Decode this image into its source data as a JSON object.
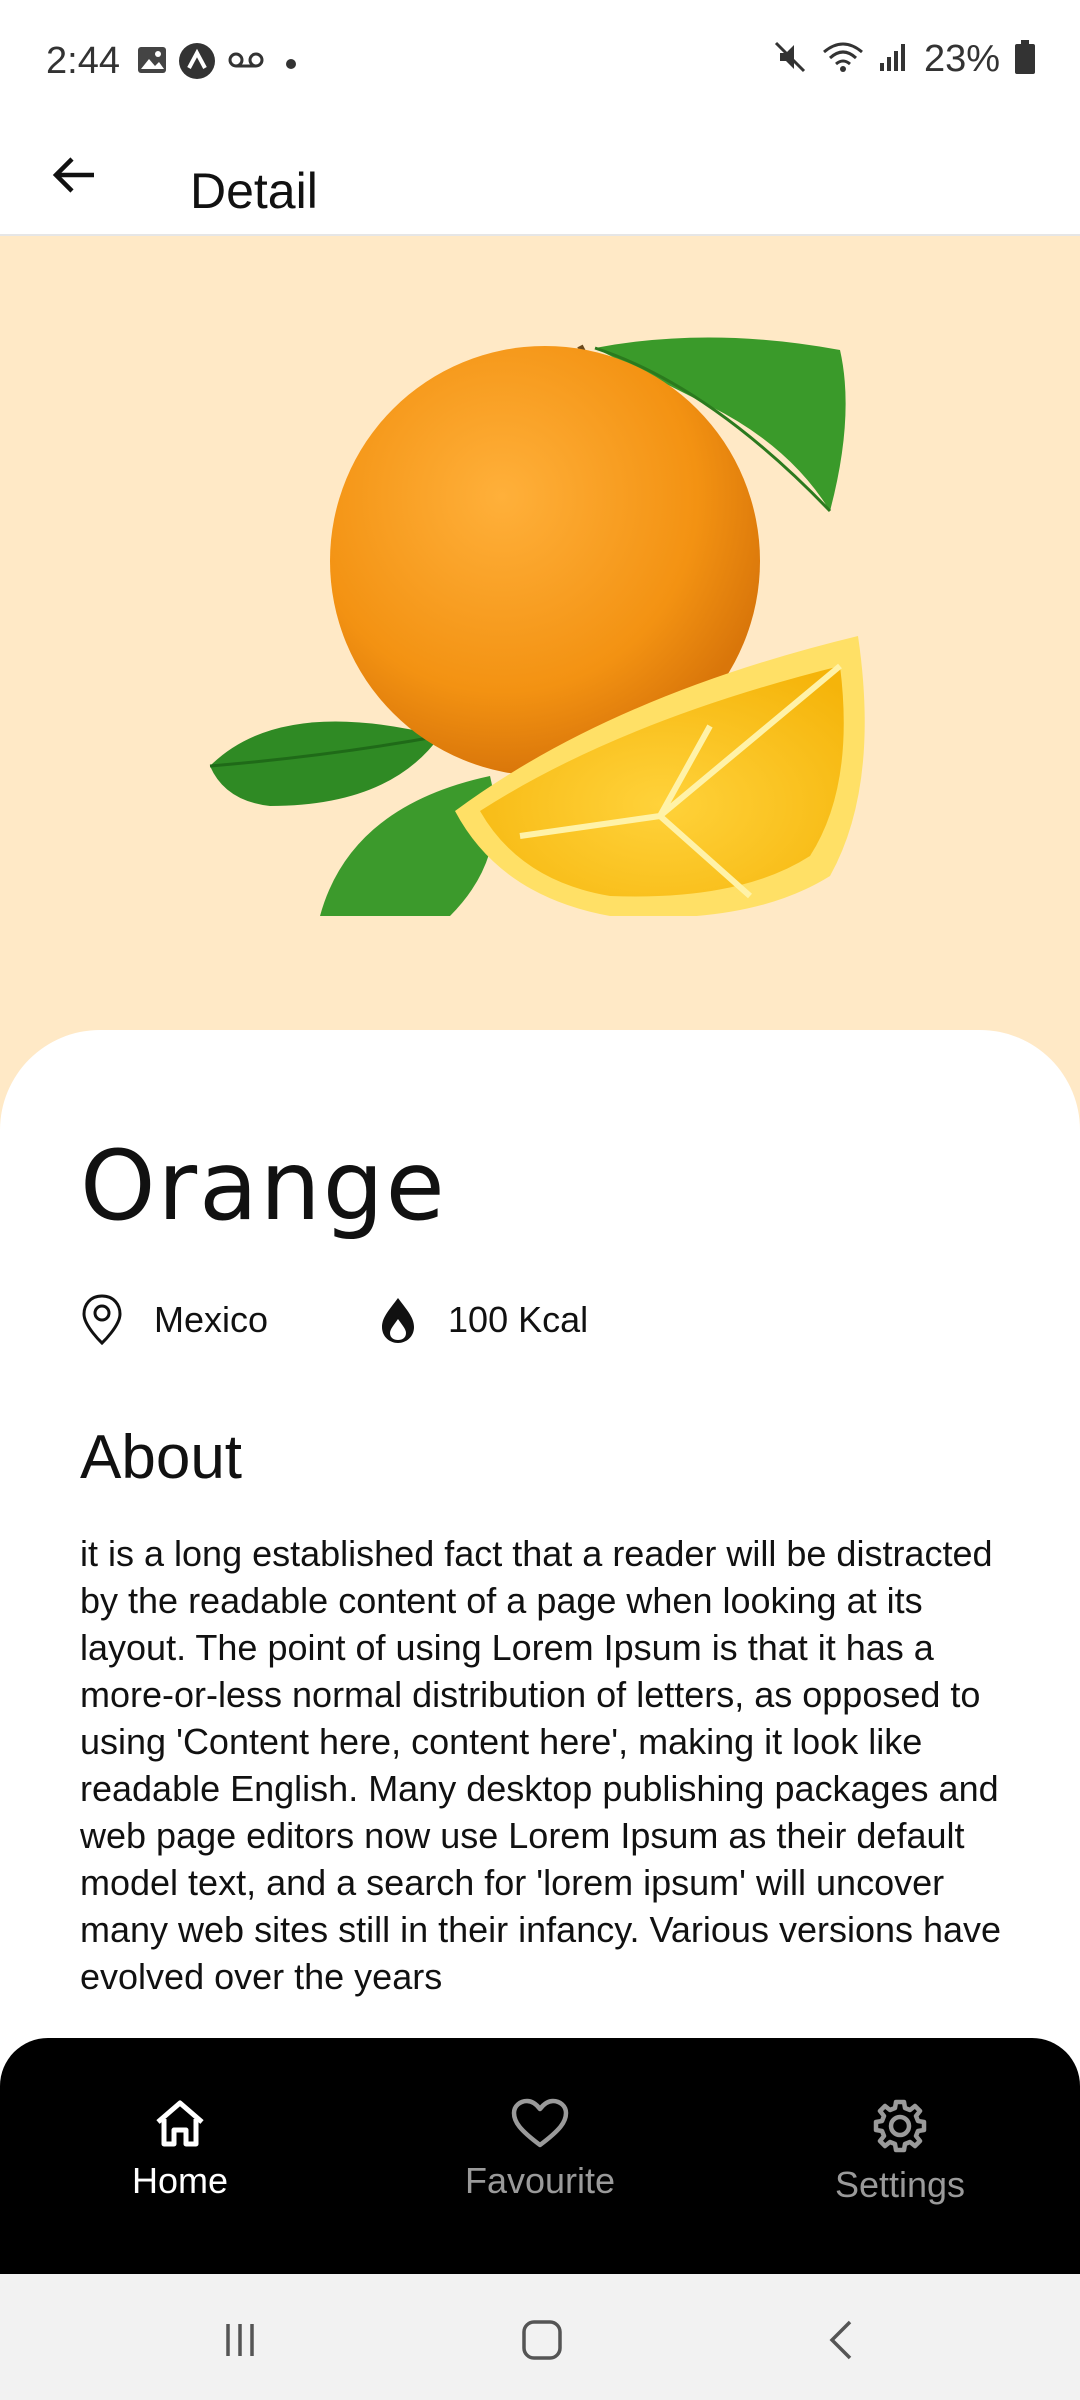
{
  "status_bar": {
    "time": "2:44",
    "battery_percent": "23%",
    "left_icons": [
      "gallery-icon",
      "app-notification-icon",
      "voicemail-icon",
      "dot-icon"
    ],
    "right_icons": [
      "mute-icon",
      "wifi-icon",
      "signal-icon",
      "battery-icon"
    ]
  },
  "app_bar": {
    "title": "Detail"
  },
  "hero": {
    "background_color": "#FFE9C6",
    "image": "orange-fruit-image"
  },
  "product": {
    "name": "Orange",
    "origin": "Mexico",
    "calories": "100 Kcal",
    "about_title": "About",
    "about_text": "it is a long established fact that a reader will be distracted by the readable content of a page when looking at its layout. The point of using Lorem Ipsum is that it has a more-or-less normal distribution of letters, as opposed to using 'Content here, content here', making it look like readable English. Many desktop publishing packages and web page editors now use Lorem Ipsum as their default model text, and a search for 'lorem ipsum' will uncover many web sites still in their infancy. Various versions have evolved over the years"
  },
  "bottom_nav": {
    "items": [
      {
        "label": "Home",
        "icon": "home-icon",
        "active": true
      },
      {
        "label": "Favourite",
        "icon": "heart-icon",
        "active": false
      },
      {
        "label": "Settings",
        "icon": "gear-icon",
        "active": false
      }
    ]
  },
  "colors": {
    "accent_bg": "#FFE9C6",
    "nav_bg": "#000000",
    "nav_active": "#ffffff",
    "nav_inactive": "#9a9a9a"
  }
}
